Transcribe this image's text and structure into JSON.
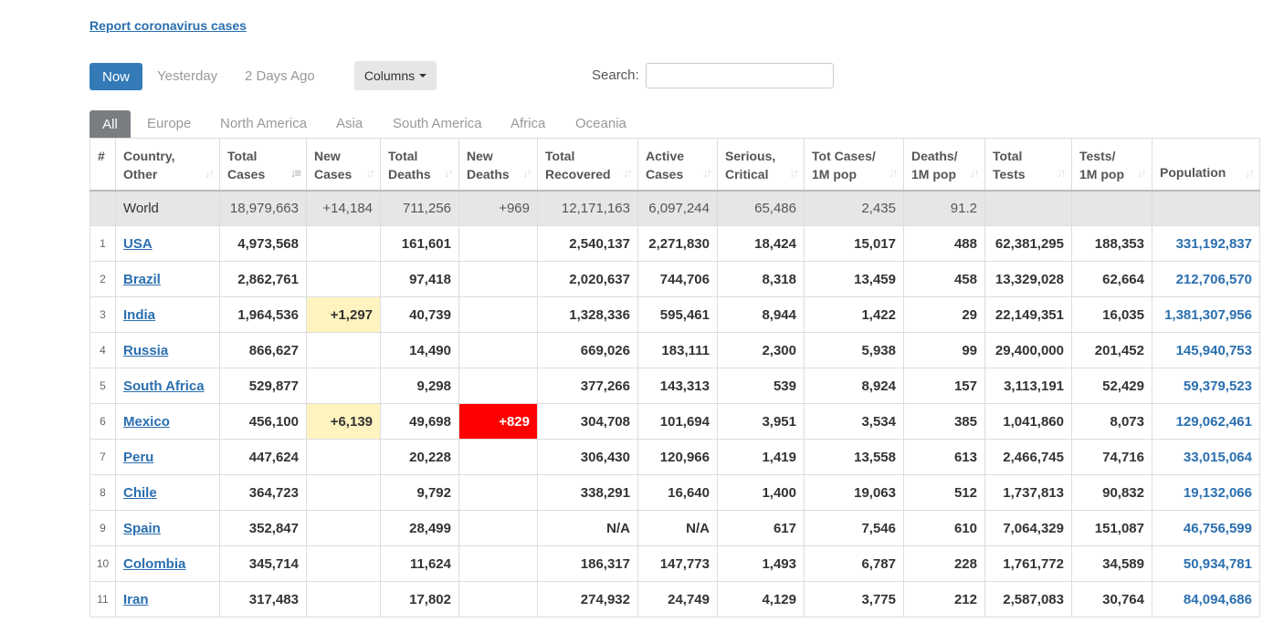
{
  "report_link": "Report coronavirus cases",
  "toolbar": {
    "now": "Now",
    "yesterday": "Yesterday",
    "two_days_ago": "2 Days Ago",
    "columns": "Columns",
    "search_label": "Search:"
  },
  "regions": [
    "All",
    "Europe",
    "North America",
    "Asia",
    "South America",
    "Africa",
    "Oceania"
  ],
  "table": {
    "headers": [
      "#",
      "Country,\nOther",
      "Total\nCases",
      "New\nCases",
      "Total\nDeaths",
      "New\nDeaths",
      "Total\nRecovered",
      "Active\nCases",
      "Serious,\nCritical",
      "Tot Cases/\n1M pop",
      "Deaths/\n1M pop",
      "Total\nTests",
      "Tests/\n1M pop",
      "Population"
    ],
    "world": [
      "",
      "World",
      "18,979,663",
      "+14,184",
      "711,256",
      "+969",
      "12,171,163",
      "6,097,244",
      "65,486",
      "2,435",
      "91.2",
      "",
      "",
      ""
    ],
    "rows": [
      [
        "1",
        "USA",
        "4,973,568",
        "",
        "161,601",
        "",
        "2,540,137",
        "2,271,830",
        "18,424",
        "15,017",
        "488",
        "62,381,295",
        "188,353",
        "331,192,837"
      ],
      [
        "2",
        "Brazil",
        "2,862,761",
        "",
        "97,418",
        "",
        "2,020,637",
        "744,706",
        "8,318",
        "13,459",
        "458",
        "13,329,028",
        "62,664",
        "212,706,570"
      ],
      [
        "3",
        "India",
        "1,964,536",
        "+1,297",
        "40,739",
        "",
        "1,328,336",
        "595,461",
        "8,944",
        "1,422",
        "29",
        "22,149,351",
        "16,035",
        "1,381,307,956"
      ],
      [
        "4",
        "Russia",
        "866,627",
        "",
        "14,490",
        "",
        "669,026",
        "183,111",
        "2,300",
        "5,938",
        "99",
        "29,400,000",
        "201,452",
        "145,940,753"
      ],
      [
        "5",
        "South Africa",
        "529,877",
        "",
        "9,298",
        "",
        "377,266",
        "143,313",
        "539",
        "8,924",
        "157",
        "3,113,191",
        "52,429",
        "59,379,523"
      ],
      [
        "6",
        "Mexico",
        "456,100",
        "+6,139",
        "49,698",
        "+829",
        "304,708",
        "101,694",
        "3,951",
        "3,534",
        "385",
        "1,041,860",
        "8,073",
        "129,062,461"
      ],
      [
        "7",
        "Peru",
        "447,624",
        "",
        "20,228",
        "",
        "306,430",
        "120,966",
        "1,419",
        "13,558",
        "613",
        "2,466,745",
        "74,716",
        "33,015,064"
      ],
      [
        "8",
        "Chile",
        "364,723",
        "",
        "9,792",
        "",
        "338,291",
        "16,640",
        "1,400",
        "19,063",
        "512",
        "1,737,813",
        "90,832",
        "19,132,066"
      ],
      [
        "9",
        "Spain",
        "352,847",
        "",
        "28,499",
        "",
        "N/A",
        "N/A",
        "617",
        "7,546",
        "610",
        "7,064,329",
        "151,087",
        "46,756,599"
      ],
      [
        "10",
        "Colombia",
        "345,714",
        "",
        "11,624",
        "",
        "186,317",
        "147,773",
        "1,493",
        "6,787",
        "228",
        "1,761,772",
        "34,589",
        "50,934,781"
      ],
      [
        "11",
        "Iran",
        "317,483",
        "",
        "17,802",
        "",
        "274,932",
        "24,749",
        "4,129",
        "3,775",
        "212",
        "2,587,083",
        "30,764",
        "84,094,686"
      ]
    ]
  },
  "colors": {
    "link_blue": "#2a6fb0",
    "now_button": "#337ab7",
    "new_cases_highlight": "#fff3bf",
    "new_deaths_highlight": "#ff0000"
  }
}
